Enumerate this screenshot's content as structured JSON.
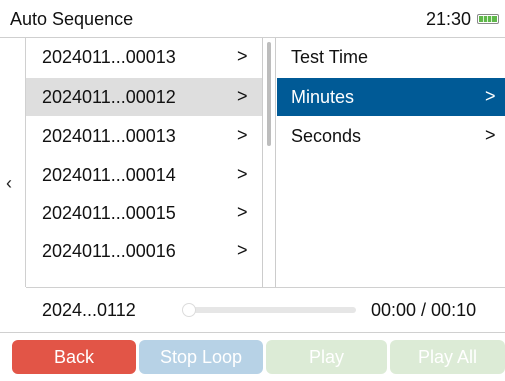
{
  "title_bar": {
    "title": "Auto Sequence",
    "time": "21:30",
    "battery_icon": "battery-icon",
    "battery_color": "#5fb84a"
  },
  "back_chevron": "‹",
  "files": [
    {
      "name": "2024011...00013",
      "arrow": ">"
    },
    {
      "name": "2024011...00012",
      "arrow": ">",
      "selected": true
    },
    {
      "name": "2024011...00013",
      "arrow": ">"
    },
    {
      "name": "2024011...00014",
      "arrow": ">"
    },
    {
      "name": "2024011...00015",
      "arrow": ">"
    },
    {
      "name": "2024011...00016",
      "arrow": ">"
    }
  ],
  "menu": {
    "header": "Test Time",
    "items": [
      {
        "label": "Minutes",
        "arrow": ">",
        "active": true
      },
      {
        "label": "Seconds",
        "arrow": ">"
      }
    ],
    "active_color": "#005a96"
  },
  "player": {
    "file": "2024...0112",
    "time": "00:00 / 00:10",
    "progress": 0
  },
  "buttons": {
    "back": "Back",
    "stop_loop": "Stop Loop",
    "play": "Play",
    "play_all": "Play All"
  },
  "colors": {
    "back_button": "#e25547",
    "stop_button": "#b7d2e6",
    "play_button": "#dcebd6"
  }
}
